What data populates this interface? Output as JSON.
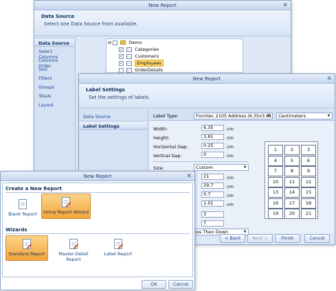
{
  "window1": {
    "title": "New Report",
    "header_title": "Data Source",
    "header_sub": "Select one Data Source from available.",
    "nav": [
      "Data Source",
      "Select Columns",
      "Columns Order",
      "Sort",
      "Filters",
      "Groups",
      "Totals",
      "Layout"
    ],
    "tree": {
      "root": "Demo",
      "items": [
        {
          "label": "Categories",
          "checked": true
        },
        {
          "label": "Customers",
          "checked": true
        },
        {
          "label": "Employees",
          "checked": true
        },
        {
          "label": "OrderDetails",
          "checked": false
        }
      ]
    }
  },
  "window2": {
    "title": "New Report",
    "header_title": "Label Settings",
    "header_sub": "Set the settings of labels.",
    "nav": [
      "Data Source",
      "Label Settings"
    ],
    "label_type_label": "Label Type:",
    "label_type_value": "Formtec 2105 Address (6.35x3.81)",
    "units_value": "Centimeters",
    "width_label": "Width:",
    "width_value": "6.35",
    "height_label": "Height:",
    "height_value": "3.81",
    "hgap_label": "Horizontal Gap:",
    "hgap_value": "0.25",
    "vgap_label": "Vertical Gap:",
    "vgap_value": "0",
    "unit": "cm",
    "size_label": "Size:",
    "size_value": "Custom",
    "size_w": "21",
    "size_h": "29.7",
    "margin_1": "0.7",
    "margin_2": "1.01",
    "columns_value": "3",
    "rows_value": "7",
    "direction_value": "ross Then Down",
    "grid": [
      "1",
      "2",
      "3",
      "4",
      "5",
      "6",
      "7",
      "8",
      "9",
      "10",
      "11",
      "12",
      "13",
      "14",
      "15",
      "16",
      "17",
      "18",
      "19",
      "20",
      "21"
    ],
    "back": "< Back",
    "next": "Next >",
    "finish": "Finish",
    "cancel": "Cancel"
  },
  "window3": {
    "title": "New Report",
    "create_heading": "Create a New Report",
    "blank": "Blank Report",
    "using_wizard": "Using Report Wizard",
    "wizards_heading": "Wizards",
    "standard": "Standard Report",
    "master_detail": "Master-Detail Report",
    "label": "Label Report",
    "ok": "OK",
    "cancel": "Cancel"
  },
  "icons": {
    "close": "close-icon",
    "dropdown": "chevron-down-icon",
    "folder": "folder-icon",
    "table": "table-icon",
    "report": "report-document-icon"
  }
}
